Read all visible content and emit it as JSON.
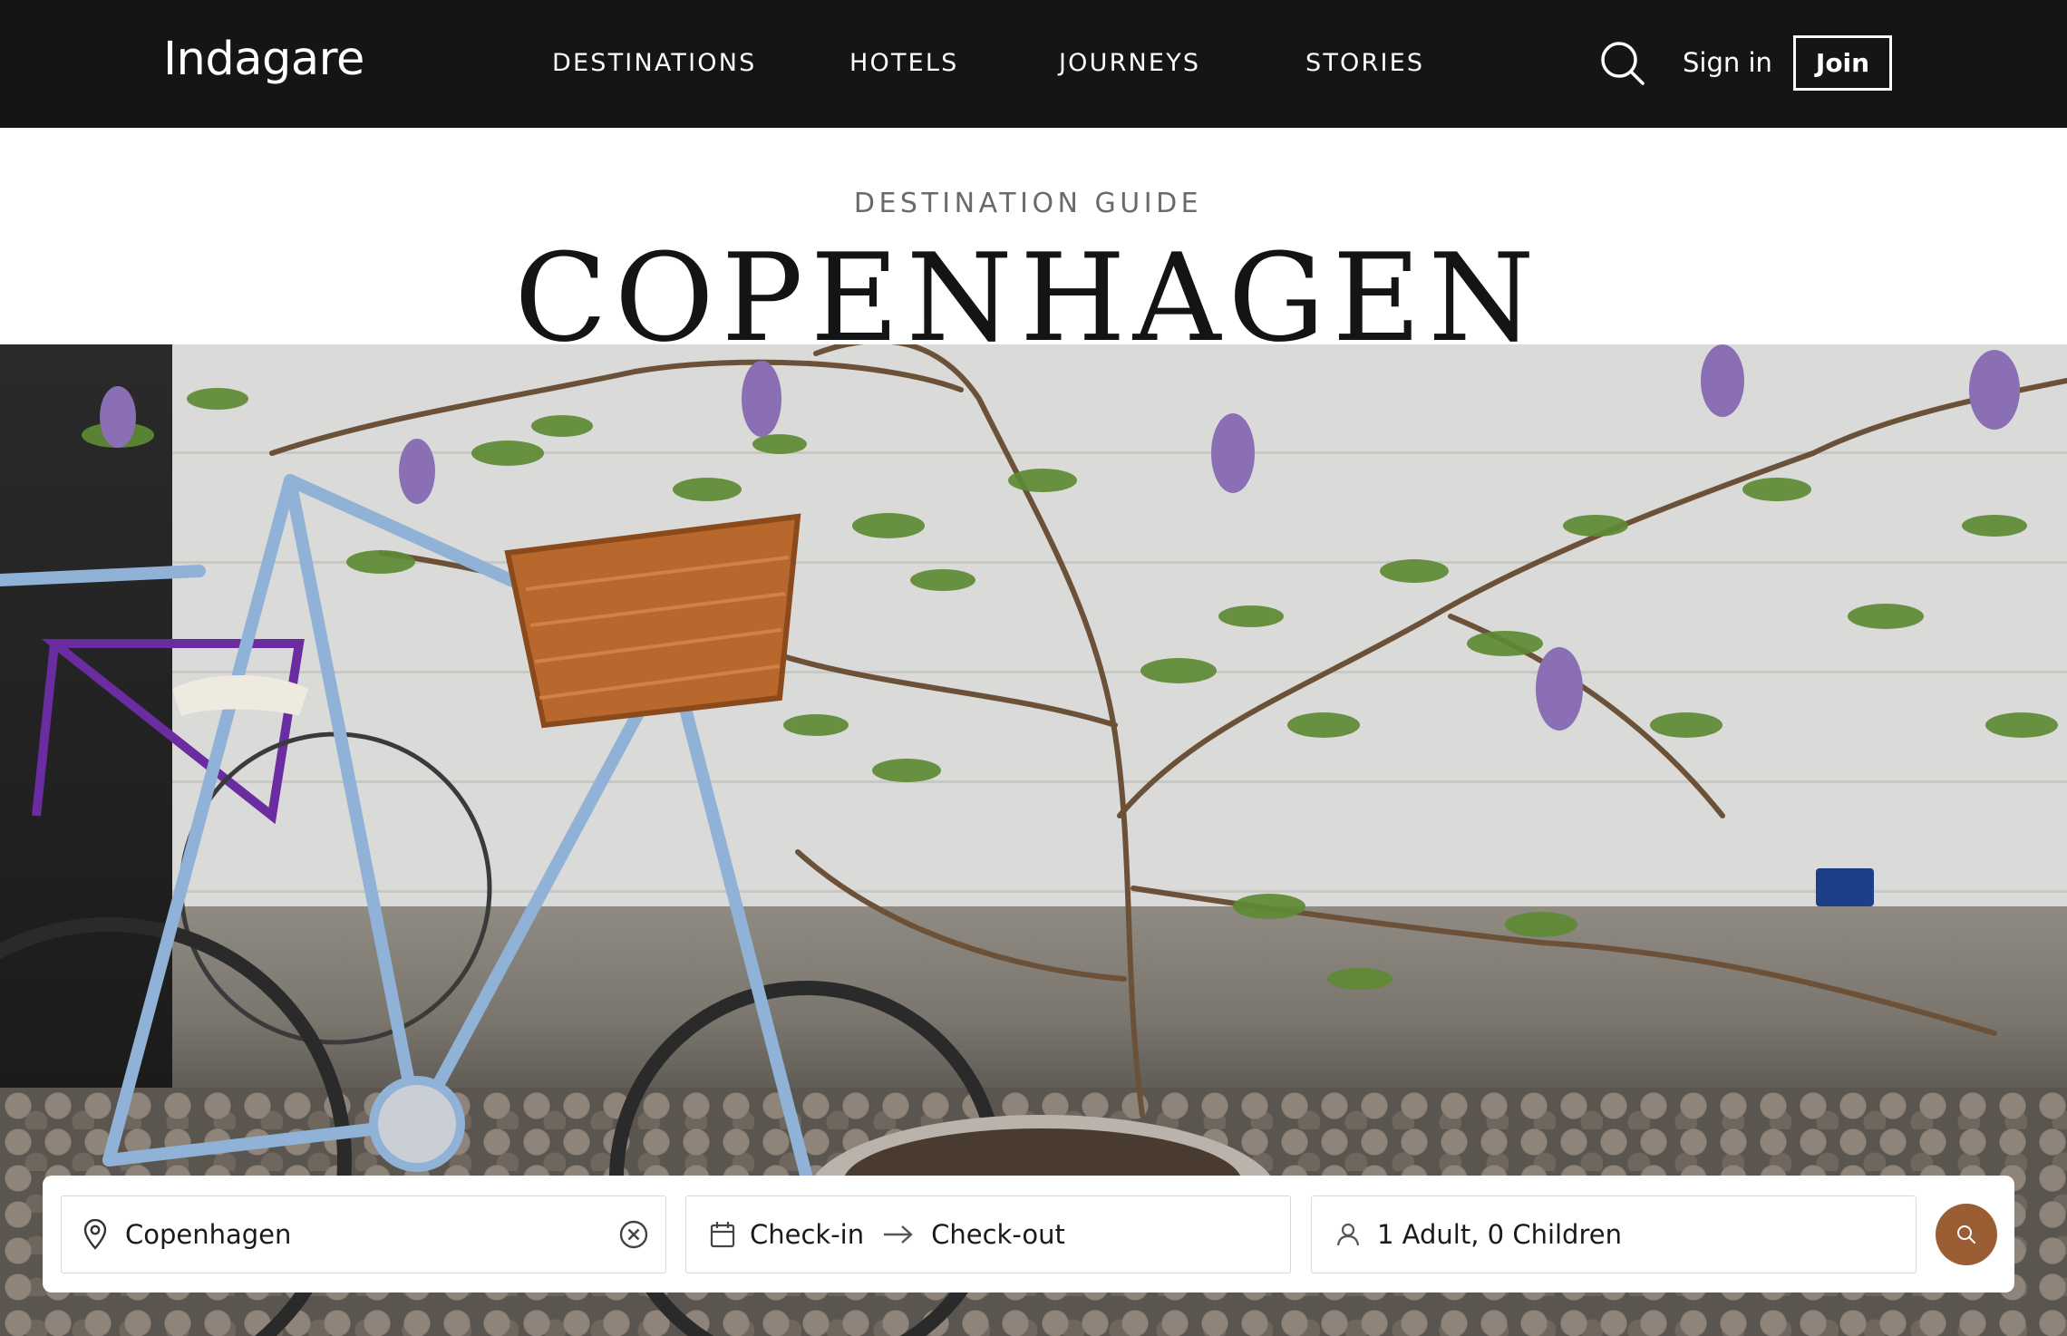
{
  "header": {
    "brand": "Indagare",
    "nav": [
      "DESTINATIONS",
      "HOTELS",
      "JOURNEYS",
      "STORIES"
    ],
    "sign_in": "Sign in",
    "join": "Join",
    "search_icon": "search-icon"
  },
  "page": {
    "kicker": "DESTINATION GUIDE",
    "title": "COPENHAGEN"
  },
  "booking": {
    "destination_value": "Copenhagen",
    "check_in": "Check-in",
    "check_out": "Check-out",
    "guests": "1 Adult, 0 Children",
    "icons": [
      "location-pin-icon",
      "clear-icon",
      "calendar-icon",
      "arrow-right-icon",
      "user-icon",
      "search-icon"
    ],
    "accent_color": "#9a5d34"
  },
  "colors": {
    "nav_background": "#151515",
    "title": "#141414",
    "kicker": "#6a6a6a"
  }
}
